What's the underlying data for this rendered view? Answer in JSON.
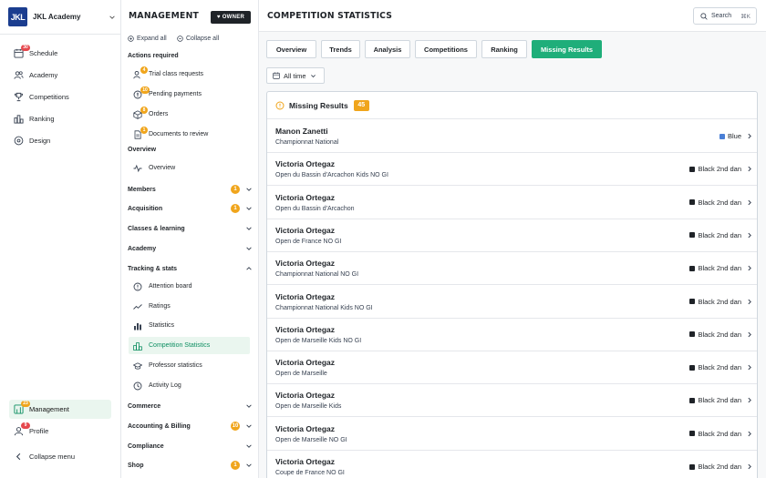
{
  "brand": {
    "logo": "JKL",
    "name": "JKL Academy"
  },
  "nav": {
    "items": [
      {
        "key": "schedule",
        "label": "Schedule",
        "icon": "calendar-icon",
        "badge": "30"
      },
      {
        "key": "academy",
        "label": "Academy",
        "icon": "users-icon"
      },
      {
        "key": "competitions",
        "label": "Competitions",
        "icon": "trophy-icon"
      },
      {
        "key": "ranking",
        "label": "Ranking",
        "icon": "ranking-icon"
      },
      {
        "key": "design",
        "label": "Design",
        "icon": "palette-icon"
      }
    ],
    "management": {
      "label": "Management",
      "badge": "23"
    },
    "profile": {
      "label": "Profile",
      "badge": "9"
    },
    "collapse": "Collapse menu"
  },
  "menu": {
    "title": "MANAGEMENT",
    "owner": "OWNER",
    "expand_all": "Expand all",
    "collapse_all": "Collapse all",
    "actions_heading": "Actions required",
    "actions": [
      {
        "label": "Trial class requests",
        "badge": "4"
      },
      {
        "label": "Pending payments",
        "badge": "10"
      },
      {
        "label": "Orders",
        "badge": "8"
      },
      {
        "label": "Documents to review",
        "badge": "1"
      }
    ],
    "overview_heading": "Overview",
    "overview_item": "Overview",
    "groups": [
      {
        "label": "Members",
        "badge": "1"
      },
      {
        "label": "Acquisition",
        "badge": "1"
      },
      {
        "label": "Classes & learning"
      },
      {
        "label": "Academy"
      },
      {
        "label": "Tracking & stats",
        "open": true
      }
    ],
    "tracking_items": [
      {
        "label": "Attention board",
        "icon": "alert-circle-icon"
      },
      {
        "label": "Ratings",
        "icon": "trend-icon"
      },
      {
        "label": "Statistics",
        "icon": "bar-chart-icon"
      },
      {
        "label": "Competition Statistics",
        "icon": "podium-icon",
        "active": true
      },
      {
        "label": "Professor statistics",
        "icon": "graduation-cap-icon"
      },
      {
        "label": "Activity Log",
        "icon": "clock-icon"
      }
    ],
    "bottom_groups": [
      {
        "label": "Commerce"
      },
      {
        "label": "Accounting & Billing",
        "badge": "10"
      },
      {
        "label": "Compliance"
      },
      {
        "label": "Shop",
        "badge": "1"
      }
    ]
  },
  "header": {
    "title": "COMPETITION STATISTICS",
    "search_label": "Search",
    "search_kbd": "⌘K"
  },
  "tabs": [
    "Overview",
    "Trends",
    "Analysis",
    "Competitions",
    "Ranking",
    "Missing Results"
  ],
  "active_tab": "Missing Results",
  "filter": {
    "label": "All time"
  },
  "panel": {
    "title": "Missing Results",
    "count": "45"
  },
  "colors": {
    "accent": "#1fae7a",
    "warning": "#f0a51c",
    "blue_belt": "#4a7fd6",
    "black_belt": "#1f2328"
  },
  "rows": [
    {
      "name": "Manon Zanetti",
      "competition": "Championnat National",
      "belt": "Blue",
      "belt_color": "#4a7fd6"
    },
    {
      "name": "Victoria Ortegaz",
      "competition": "Open du Bassin d'Arcachon Kids NO GI",
      "belt": "Black 2nd dan",
      "belt_color": "#1f2328"
    },
    {
      "name": "Victoria Ortegaz",
      "competition": "Open du Bassin d'Arcachon",
      "belt": "Black 2nd dan",
      "belt_color": "#1f2328"
    },
    {
      "name": "Victoria Ortegaz",
      "competition": "Open de France NO GI",
      "belt": "Black 2nd dan",
      "belt_color": "#1f2328"
    },
    {
      "name": "Victoria Ortegaz",
      "competition": "Championnat National NO GI",
      "belt": "Black 2nd dan",
      "belt_color": "#1f2328"
    },
    {
      "name": "Victoria Ortegaz",
      "competition": "Championnat National Kids NO GI",
      "belt": "Black 2nd dan",
      "belt_color": "#1f2328"
    },
    {
      "name": "Victoria Ortegaz",
      "competition": "Open de Marseille Kids NO GI",
      "belt": "Black 2nd dan",
      "belt_color": "#1f2328"
    },
    {
      "name": "Victoria Ortegaz",
      "competition": "Open de Marseille",
      "belt": "Black 2nd dan",
      "belt_color": "#1f2328"
    },
    {
      "name": "Victoria Ortegaz",
      "competition": "Open de Marseille Kids",
      "belt": "Black 2nd dan",
      "belt_color": "#1f2328"
    },
    {
      "name": "Victoria Ortegaz",
      "competition": "Open de Marseille NO GI",
      "belt": "Black 2nd dan",
      "belt_color": "#1f2328"
    },
    {
      "name": "Victoria Ortegaz",
      "competition": "Coupe de France NO GI",
      "belt": "Black 2nd dan",
      "belt_color": "#1f2328"
    }
  ]
}
